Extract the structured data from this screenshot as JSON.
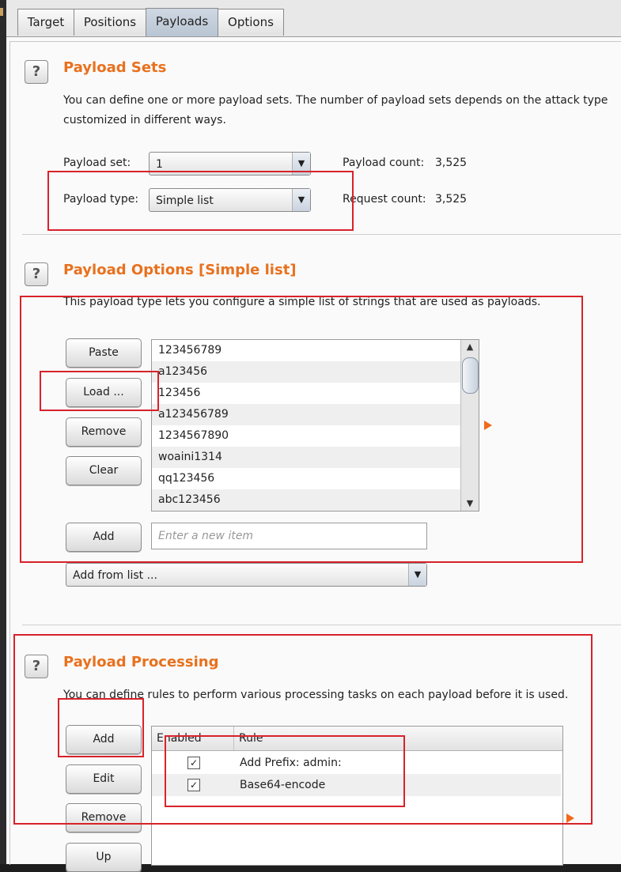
{
  "tabs": [
    {
      "label": "Target"
    },
    {
      "label": "Positions"
    },
    {
      "label": "Payloads"
    },
    {
      "label": "Options"
    }
  ],
  "active_tab": "Payloads",
  "payload_sets": {
    "help": "?",
    "title": "Payload Sets",
    "desc_line1": "You can define one or more payload sets. The number of payload sets depends on the attack type",
    "desc_line2": "customized in different ways.",
    "set_label": "Payload set:",
    "set_value": "1",
    "type_label": "Payload type:",
    "type_value": "Simple list",
    "payload_count_label": "Payload count:",
    "payload_count": "3,525",
    "request_count_label": "Request count:",
    "request_count": "3,525"
  },
  "payload_options": {
    "help": "?",
    "title": "Payload Options [Simple list]",
    "desc": "This payload type lets you configure a simple list of strings that are used as payloads.",
    "buttons": {
      "paste": "Paste",
      "load": "Load ...",
      "remove": "Remove",
      "clear": "Clear",
      "add": "Add"
    },
    "items": [
      "123456789",
      "a123456",
      "123456",
      "a123456789",
      "1234567890",
      "woaini1314",
      "qq123456",
      "abc123456"
    ],
    "new_item_placeholder": "Enter a new item",
    "add_from_list": "Add from list ..."
  },
  "payload_processing": {
    "help": "?",
    "title": "Payload Processing",
    "desc": "You can define rules to perform various processing tasks on each payload before it is used.",
    "buttons": {
      "add": "Add",
      "edit": "Edit",
      "remove": "Remove",
      "up": "Up"
    },
    "columns": {
      "enabled": "Enabled",
      "rule": "Rule"
    },
    "rules": [
      {
        "enabled": true,
        "check": "✓",
        "rule": "Add Prefix: admin:"
      },
      {
        "enabled": true,
        "check": "✓",
        "rule": "Base64-encode"
      }
    ]
  },
  "colors": {
    "heading": "#e8711e",
    "annotation": "#d8222a",
    "play_arrow": "#f06a1c"
  },
  "icons": {
    "dropdown": "▼",
    "scroll_up": "▲",
    "scroll_down": "▼"
  }
}
